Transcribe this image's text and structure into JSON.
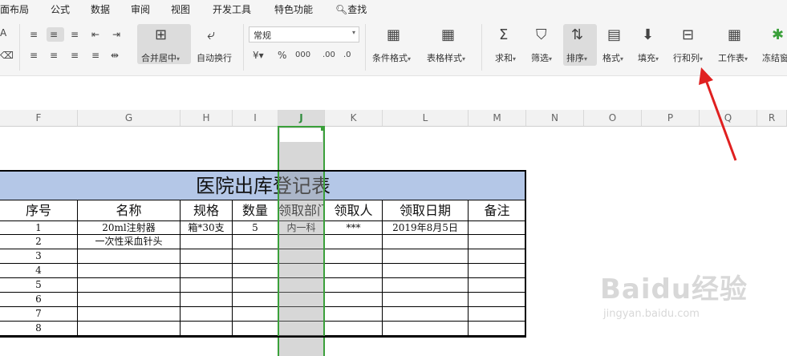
{
  "menu": [
    "面布局",
    "公式",
    "数据",
    "审阅",
    "视图",
    "开发工具",
    "特色功能"
  ],
  "search_label": "查找",
  "ribbon": {
    "merge_label": "合并居中",
    "wrap_label": "自动换行",
    "number_format": "常规",
    "conditional_format": "条件格式",
    "table_style": "表格样式",
    "sum": "求和",
    "filter": "筛选",
    "sort": "排序",
    "format": "格式",
    "fill": "填充",
    "rowcol": "行和列",
    "worksheet": "工作表",
    "freeze": "冻结窗"
  },
  "columns": [
    "F",
    "G",
    "H",
    "I",
    "J",
    "K",
    "L",
    "M",
    "N",
    "O",
    "P",
    "Q",
    "R"
  ],
  "selected_column": "J",
  "table": {
    "title": "医院出库登记表",
    "headers": [
      "序号",
      "名称",
      "规格",
      "数量",
      "领取部门",
      "领取人",
      "领取日期",
      "备注"
    ],
    "rows": [
      [
        "1",
        "20ml注射器",
        "箱*30支",
        "5",
        "内一科",
        "***",
        "2019年8月5日",
        ""
      ],
      [
        "2",
        "一次性采血针头",
        "",
        "",
        "",
        "",
        "",
        ""
      ],
      [
        "3",
        "",
        "",
        "",
        "",
        "",
        "",
        ""
      ],
      [
        "4",
        "",
        "",
        "",
        "",
        "",
        "",
        ""
      ],
      [
        "5",
        "",
        "",
        "",
        "",
        "",
        "",
        ""
      ],
      [
        "6",
        "",
        "",
        "",
        "",
        "",
        "",
        ""
      ],
      [
        "7",
        "",
        "",
        "",
        "",
        "",
        "",
        ""
      ],
      [
        "8",
        "",
        "",
        "",
        "",
        "",
        "",
        ""
      ]
    ]
  },
  "watermark": {
    "main": "Baidu经验",
    "sub": "jingyan.baidu.com"
  },
  "colors": {
    "accent_green": "#3aa03a",
    "title_fill": "#b4c7e7",
    "arrow_red": "#e02020"
  }
}
